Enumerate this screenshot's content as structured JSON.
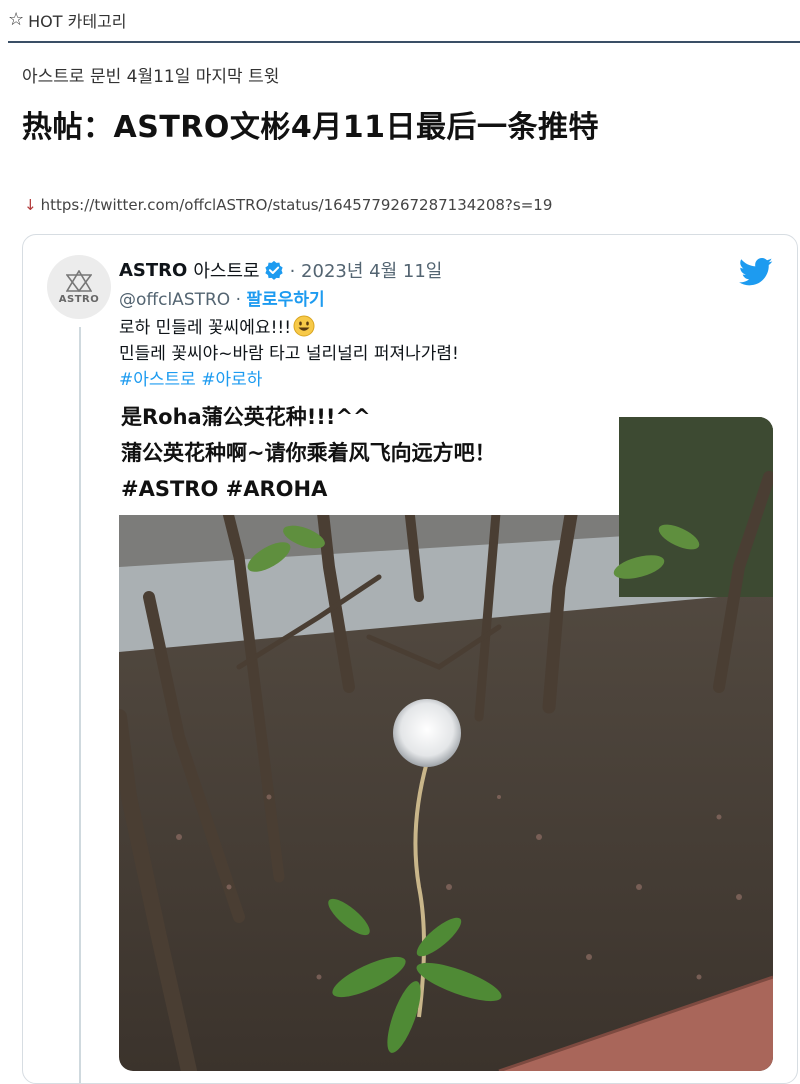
{
  "header": {
    "star_icon": "star-outline-icon",
    "category": "HOT 카테고리"
  },
  "post": {
    "kr_title": "아스트로 문빈 4월11일 마지막 트윗",
    "cn_title": "热帖：ASTRO文彬4月11日最后一条推特",
    "link": "https://twitter.com/offclASTRO/status/1645779267287134208?s=19"
  },
  "tweet": {
    "name": "ASTRO",
    "kr_name": "아스트로",
    "date": "· 2023년 4월 11일",
    "handle": "@offclASTRO ·",
    "follow": "팔로우하기",
    "avatar_text": "ASTRO",
    "line1": "로하 민들레 꽃씨에요!!!",
    "line2": "민들레 꽃씨야~바람 타고 널리널리 퍼져나가렴!",
    "tags": "#아스트로 #아로하",
    "icons": [
      "verified-badge-icon",
      "twitter-bird-icon",
      "smile-emoji-icon"
    ],
    "accent": "#1d9bf0"
  },
  "translation": {
    "line1": "是Roha蒲公英花种!!!^^",
    "line2": "蒲公英花种啊~请你乘着风飞向远方吧！",
    "line3": "#ASTRO #AROHA"
  }
}
